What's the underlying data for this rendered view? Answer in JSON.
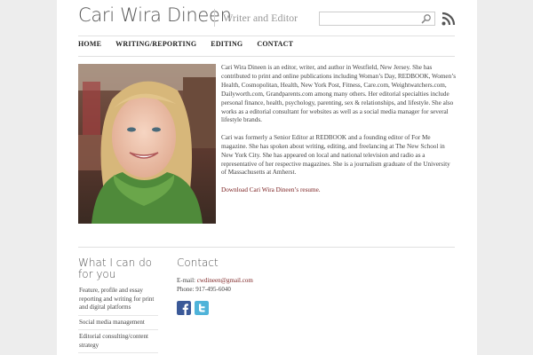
{
  "header": {
    "site_title": "Cari Wira Dineen",
    "tagline": "Writer and Editor",
    "search_placeholder": ""
  },
  "nav": {
    "items": [
      {
        "label": "HOME"
      },
      {
        "label": "WRITING/REPORTING"
      },
      {
        "label": "EDITING"
      },
      {
        "label": "CONTACT"
      }
    ]
  },
  "bio": {
    "paragraph_1": "Cari Wira Dineen is an editor, writer, and author in Westfield, New Jersey. She has contributed to print and online publications including Woman’s Day, REDBOOK, Women’s Health, Cosmopolitan, Health, New York Post, Fitness, Care.com, Weightwatchers.com, Dailyworth.com, Grandparents.com among many others. Her editorial specialties include personal finance, health, psychology, parenting, sex & relationships, and lifestyle. She also works as a editorial consultant for websites as well as a social media manager for several lifestyle brands.",
    "paragraph_2": "Cari was formerly a Senior Editor at REDBOOK and a founding editor of For Me magazine. She has spoken about writing, editing, and freelancing at The New School in New York City. She has appeared on local and national television and radio as a representative of her respective magazines. She is a journalism graduate of the University of Massachusetts at Amherst.",
    "resume_link": "Download Cari Wira Dineen’s resume."
  },
  "what_i_can_do": {
    "title": "What I can do for you",
    "items": [
      "Feature, profile and essay reporting and writing for print and digital platforms",
      "Social media management",
      "Editorial consulting/content strategy"
    ]
  },
  "contact": {
    "title": "Contact",
    "email_label": "E-mail:",
    "email": "cwdineen@gmail.com",
    "phone_label": "Phone:",
    "phone": "917-495-6040"
  },
  "colors": {
    "link": "#7a1f1f",
    "facebook": "#3b5998",
    "twitter": "#4fb3d9",
    "rss": "#555555"
  },
  "icons": [
    "search-icon",
    "rss-icon",
    "facebook-icon",
    "twitter-icon"
  ]
}
